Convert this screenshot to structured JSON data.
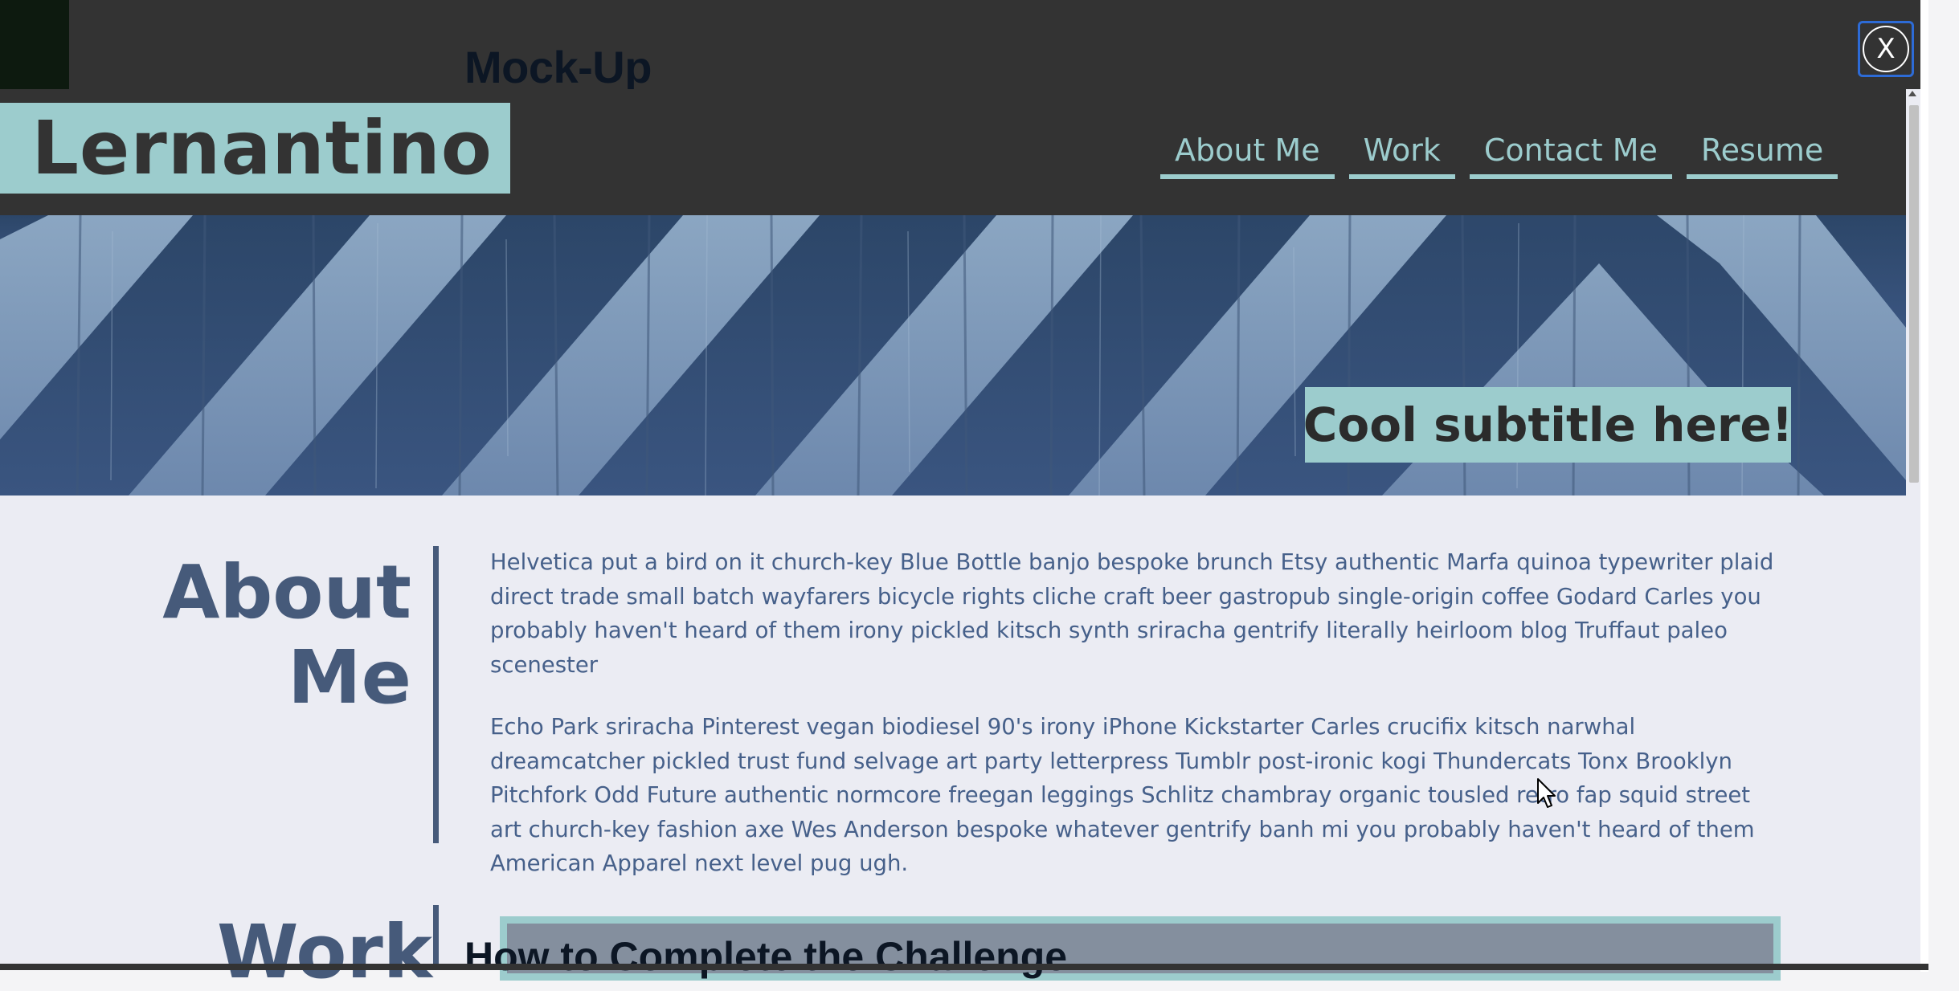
{
  "backdrop": {
    "heading": "Mock-Up",
    "bottom_heading": "How to Complete the Challenge"
  },
  "close_button": {
    "label": "X"
  },
  "site": {
    "brand": "Lernantino",
    "nav": [
      {
        "label": "About Me"
      },
      {
        "label": "Work"
      },
      {
        "label": "Contact Me"
      },
      {
        "label": "Resume"
      }
    ],
    "hero_subtitle": "Cool subtitle here!",
    "about": {
      "heading_line1": "About",
      "heading_line2": "Me",
      "paragraphs": [
        "Helvetica put a bird on it church-key Blue Bottle banjo bespoke brunch Etsy authentic Marfa quinoa typewriter plaid direct trade small batch wayfarers bicycle rights cliche craft beer gastropub single-origin coffee Godard Carles you probably haven't heard of them irony pickled kitsch synth sriracha gentrify literally heirloom blog Truffaut paleo scenester",
        "Echo Park sriracha Pinterest vegan biodiesel 90's irony iPhone Kickstarter Carles crucifix kitsch narwhal dreamcatcher pickled trust fund selvage art party letterpress Tumblr post-ironic kogi Thundercats Tonx Brooklyn Pitchfork Odd Future authentic normcore freegan leggings Schlitz chambray organic tousled retro fap squid street art church-key fashion axe Wes Anderson bespoke whatever gentrify banh mi you probably haven't heard of them American Apparel next level pug ugh."
      ]
    },
    "work": {
      "heading": "Work"
    }
  },
  "colors": {
    "accent": "#9ccccd",
    "header_bg": "#333333",
    "heading_text": "#465a7a",
    "body_text": "#46608a",
    "page_bg": "#ebecf3",
    "focus_outline": "#2d6bd6"
  },
  "icons": {
    "close": "close-icon",
    "cursor": "mouse-pointer-icon"
  }
}
